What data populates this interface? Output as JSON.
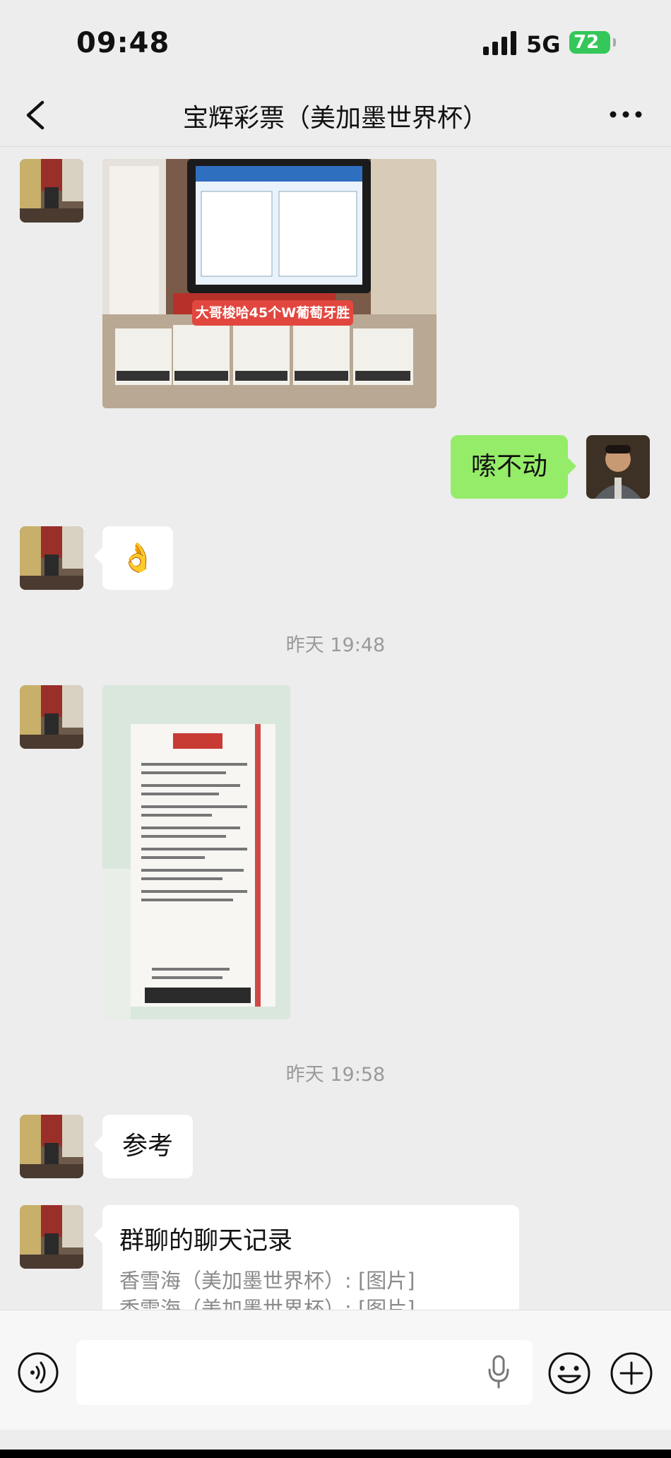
{
  "status_bar": {
    "time": "09:48",
    "network": "5G",
    "battery": "72"
  },
  "header": {
    "title": "宝辉彩票（美加墨世界杯）"
  },
  "messages": {
    "image1_caption": "大哥梭哈45个W葡萄牙胜",
    "text_right": "嗦不动",
    "emoji_left": "👌",
    "time1": "昨天 19:48",
    "time2": "昨天 19:58",
    "text_left": "参考",
    "chat_record": {
      "title": "群聊的聊天记录",
      "line1": "香雪海（美加墨世界杯）: [图片]",
      "line2": "香雪海（美加墨世界杯）: [图片]"
    }
  },
  "icons": [
    "back-icon",
    "more-icon",
    "voice-icon",
    "mic-icon",
    "emoji-icon",
    "plus-icon"
  ],
  "colors": {
    "self_bubble": "#95ec69",
    "other_bubble": "#ffffff",
    "background": "#ededed"
  }
}
